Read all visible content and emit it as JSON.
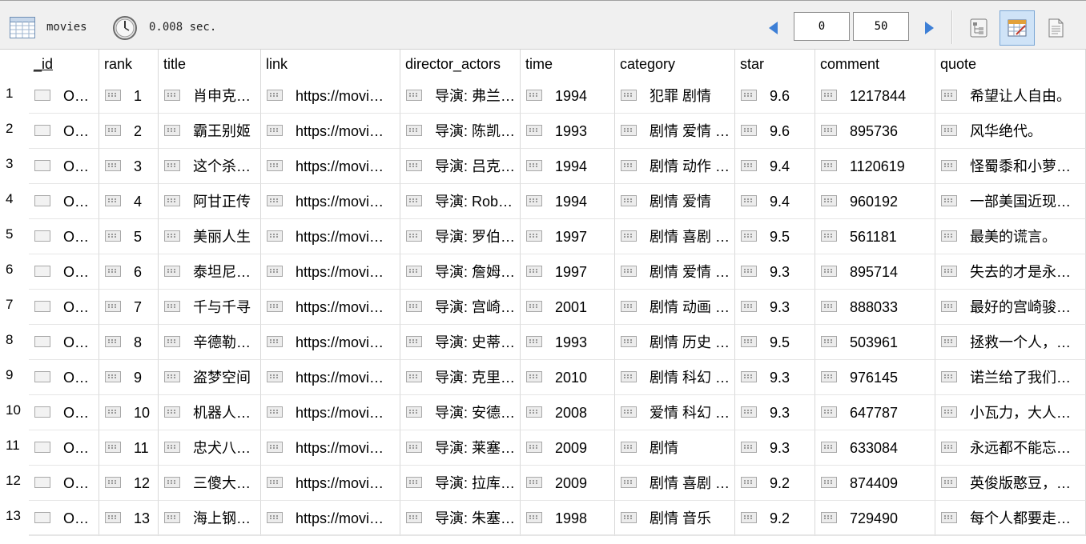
{
  "toolbar": {
    "collection": "movies",
    "elapsed": "0.008 sec.",
    "skip": "0",
    "limit": "50"
  },
  "columns": [
    "_id",
    "rank",
    "title",
    "link",
    "director_actors",
    "time",
    "category",
    "star",
    "comment",
    "quote"
  ],
  "rows": [
    {
      "n": "1",
      "id": "O…",
      "rank": "1",
      "title": "肖申克…",
      "link": "https://movi…",
      "director": "导演: 弗兰…",
      "time": "1994",
      "category": "犯罪 剧情",
      "star": "9.6",
      "comment": "1217844",
      "quote": "希望让人自由。"
    },
    {
      "n": "2",
      "id": "O…",
      "rank": "2",
      "title": "霸王别姬",
      "link": "https://movi…",
      "director": "导演: 陈凯…",
      "time": "1993",
      "category": "剧情 爱情 …",
      "star": "9.6",
      "comment": "895736",
      "quote": "风华绝代。"
    },
    {
      "n": "3",
      "id": "O…",
      "rank": "3",
      "title": "这个杀…",
      "link": "https://movi…",
      "director": "导演: 吕克…",
      "time": "1994",
      "category": "剧情 动作 …",
      "star": "9.4",
      "comment": "1120619",
      "quote": "怪蜀黍和小萝莉…"
    },
    {
      "n": "4",
      "id": "O…",
      "rank": "4",
      "title": "阿甘正传",
      "link": "https://movi…",
      "director": "导演: Rob…",
      "time": "1994",
      "category": "剧情 爱情",
      "star": "9.4",
      "comment": "960192",
      "quote": "一部美国近现代…"
    },
    {
      "n": "5",
      "id": "O…",
      "rank": "5",
      "title": "美丽人生",
      "link": "https://movi…",
      "director": "导演: 罗伯…",
      "time": "1997",
      "category": "剧情 喜剧 …",
      "star": "9.5",
      "comment": "561181",
      "quote": "最美的谎言。"
    },
    {
      "n": "6",
      "id": "O…",
      "rank": "6",
      "title": "泰坦尼…",
      "link": "https://movi…",
      "director": "导演: 詹姆…",
      "time": "1997",
      "category": "剧情 爱情 …",
      "star": "9.3",
      "comment": "895714",
      "quote": "失去的才是永恒…"
    },
    {
      "n": "7",
      "id": "O…",
      "rank": "7",
      "title": "千与千寻",
      "link": "https://movi…",
      "director": "导演: 宫崎…",
      "time": "2001",
      "category": "剧情 动画 …",
      "star": "9.3",
      "comment": "888033",
      "quote": "最好的宫崎骏，…"
    },
    {
      "n": "8",
      "id": "O…",
      "rank": "8",
      "title": "辛德勒…",
      "link": "https://movi…",
      "director": "导演: 史蒂…",
      "time": "1993",
      "category": "剧情 历史 …",
      "star": "9.5",
      "comment": "503961",
      "quote": "拯救一个人，就…"
    },
    {
      "n": "9",
      "id": "O…",
      "rank": "9",
      "title": "盗梦空间",
      "link": "https://movi…",
      "director": "导演: 克里…",
      "time": "2010",
      "category": "剧情 科幻 …",
      "star": "9.3",
      "comment": "976145",
      "quote": "诺兰给了我们一…"
    },
    {
      "n": "10",
      "id": "O…",
      "rank": "10",
      "title": "机器人…",
      "link": "https://movi…",
      "director": "导演: 安德…",
      "time": "2008",
      "category": "爱情 科幻 …",
      "star": "9.3",
      "comment": "647787",
      "quote": "小瓦力，大人生。"
    },
    {
      "n": "11",
      "id": "O…",
      "rank": "11",
      "title": "忠犬八…",
      "link": "https://movi…",
      "director": "导演: 莱塞…",
      "time": "2009",
      "category": "剧情",
      "star": "9.3",
      "comment": "633084",
      "quote": "永远都不能忘记…"
    },
    {
      "n": "12",
      "id": "O…",
      "rank": "12",
      "title": "三傻大…",
      "link": "https://movi…",
      "director": "导演: 拉库…",
      "time": "2009",
      "category": "剧情 喜剧 …",
      "star": "9.2",
      "comment": "874409",
      "quote": "英俊版憨豆，高…"
    },
    {
      "n": "13",
      "id": "O…",
      "rank": "13",
      "title": "海上钢…",
      "link": "https://movi…",
      "director": "导演: 朱塞…",
      "time": "1998",
      "category": "剧情 音乐",
      "star": "9.2",
      "comment": "729490",
      "quote": "每个人都要走一…"
    }
  ]
}
